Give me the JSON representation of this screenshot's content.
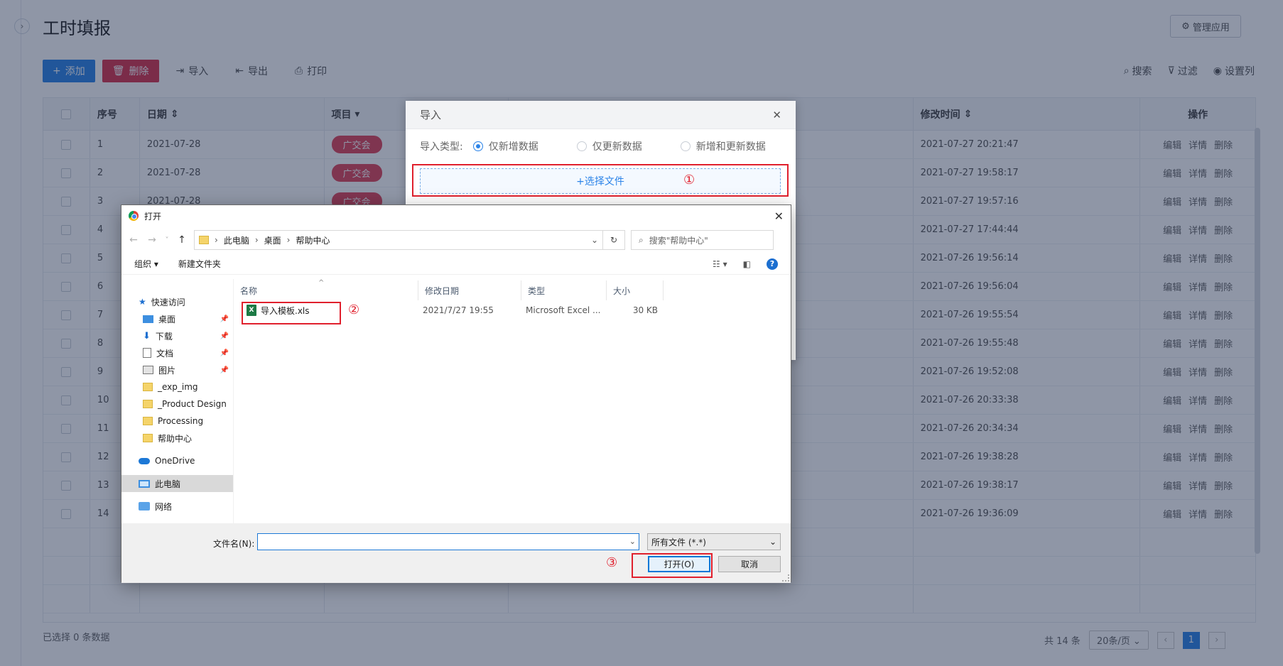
{
  "app": {
    "title": "工时填报",
    "manage_label": "管理应用",
    "toolbar": {
      "add": "添加",
      "delete": "删除",
      "import": "导入",
      "export": "导出",
      "print": "打印",
      "search": "搜索",
      "filter": "过滤",
      "set_columns": "设置列"
    },
    "grid": {
      "headers": {
        "no": "序号",
        "date": "日期",
        "project": "项目",
        "modified": "修改时间",
        "ops": "操作"
      },
      "tag": "广交会",
      "ops": [
        "编辑",
        "详情",
        "删除"
      ],
      "rows": [
        {
          "no": "1",
          "date": "2021-07-28",
          "modified": "2021-07-27 20:21:47"
        },
        {
          "no": "2",
          "date": "2021-07-28",
          "modified": "2021-07-27 19:58:17"
        },
        {
          "no": "3",
          "date": "2021-07-28",
          "modified": "2021-07-27 19:57:16"
        },
        {
          "no": "4",
          "date": "",
          "modified": "2021-07-27 17:44:44"
        },
        {
          "no": "5",
          "date": "",
          "modified": "2021-07-26 19:56:14"
        },
        {
          "no": "6",
          "date": "",
          "modified": "2021-07-26 19:56:04"
        },
        {
          "no": "7",
          "date": "",
          "modified": "2021-07-26 19:55:54"
        },
        {
          "no": "8",
          "date": "",
          "modified": "2021-07-26 19:55:48"
        },
        {
          "no": "9",
          "date": "",
          "modified": "2021-07-26 19:52:08"
        },
        {
          "no": "10",
          "date": "",
          "modified": "2021-07-26 20:33:38"
        },
        {
          "no": "11",
          "date": "",
          "modified": "2021-07-26 20:34:34"
        },
        {
          "no": "12",
          "date": "",
          "modified": "2021-07-26 19:38:28"
        },
        {
          "no": "13",
          "date": "",
          "modified": "2021-07-26 19:38:17"
        },
        {
          "no": "14",
          "date": "",
          "modified": "2021-07-26 19:36:09"
        }
      ]
    },
    "footer": {
      "selected": "已选择 0 条数据",
      "total": "共 14 条",
      "page_size": "20条/页",
      "current_page": "1"
    }
  },
  "import_dialog": {
    "title": "导入",
    "type_label": "导入类型:",
    "options": [
      "仅新增数据",
      "仅更新数据",
      "新增和更新数据"
    ],
    "selected_option": "仅新增数据",
    "choose_file": "+选择文件"
  },
  "annotations": {
    "one": "①",
    "two": "②",
    "three": "③"
  },
  "open_dialog": {
    "title": "打开",
    "breadcrumb": [
      "此电脑",
      "桌面",
      "帮助中心"
    ],
    "search_placeholder": "搜索\"帮助中心\"",
    "organize": "组织 ▾",
    "new_folder": "新建文件夹",
    "nav": {
      "quick_access": "快速访问",
      "desktop": "桌面",
      "downloads": "下载",
      "documents": "文档",
      "pictures": "图片",
      "exp_img": "_exp_img",
      "product_design": "_Product Design",
      "processing": "Processing",
      "help_center": "帮助中心",
      "onedrive": "OneDrive",
      "this_pc": "此电脑",
      "network": "网络"
    },
    "columns": {
      "name": "名称",
      "modified": "修改日期",
      "type": "类型",
      "size": "大小"
    },
    "files": [
      {
        "name": "导入模板.xls",
        "modified": "2021/7/27 19:55",
        "type": "Microsoft Excel ...",
        "size": "30 KB"
      }
    ],
    "filename_label": "文件名(N):",
    "filename_value": "",
    "filetype": "所有文件 (*.*)",
    "open_btn": "打开(O)",
    "cancel_btn": "取消"
  }
}
